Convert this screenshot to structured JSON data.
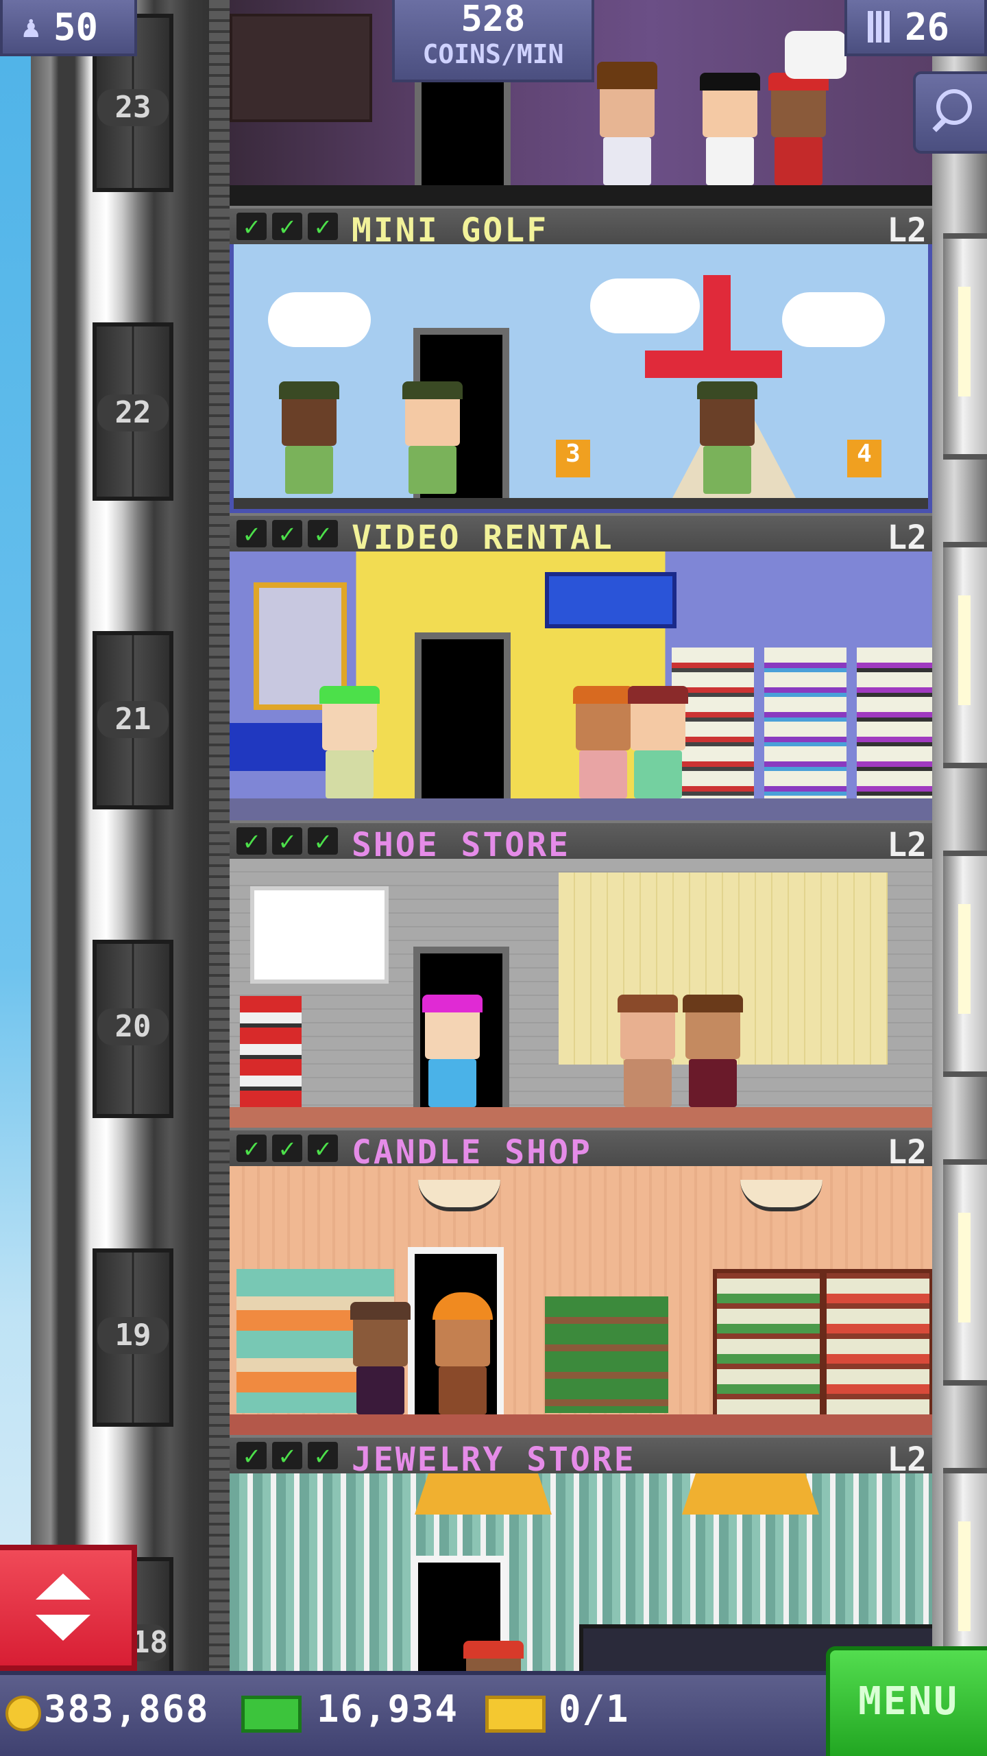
{
  "hud": {
    "population": "50",
    "coins_rate": "528",
    "coins_rate_unit": "COINS/MIN",
    "floors_count": "26"
  },
  "elevator": {
    "floor_numbers": [
      "23",
      "22",
      "21",
      "20",
      "19",
      "18"
    ]
  },
  "floors": [
    {
      "name": "MINI GOLF",
      "level": "L2",
      "name_color": "#f2f29a",
      "checks": 3
    },
    {
      "name": "VIDEO RENTAL",
      "level": "L2",
      "name_color": "#f2f29a",
      "checks": 3
    },
    {
      "name": "SHOE STORE",
      "level": "L2",
      "name_color": "#e58ce8",
      "checks": 3
    },
    {
      "name": "CANDLE SHOP",
      "level": "L2",
      "name_color": "#e58ce8",
      "checks": 3
    },
    {
      "name": "JEWELRY STORE",
      "level": "L2",
      "name_color": "#e58ce8",
      "checks": 3
    }
  ],
  "bottom_bar": {
    "coins": "383,868",
    "bux": "16,934",
    "tickets": "0/1",
    "menu_label": "MENU"
  },
  "icons": {
    "population": "person-icon",
    "floors": "building-icon",
    "search": "magnifier-icon",
    "elevator": "elevator-arrows-icon",
    "coin": "coin-icon",
    "bux": "bux-icon",
    "ticket": "ticket-icon",
    "check": "check-icon"
  },
  "colors": {
    "check": "#4ce04a",
    "menu": "#2fbf2c",
    "elevator_button": "#e0283c",
    "hud": "#5a5d8f"
  }
}
